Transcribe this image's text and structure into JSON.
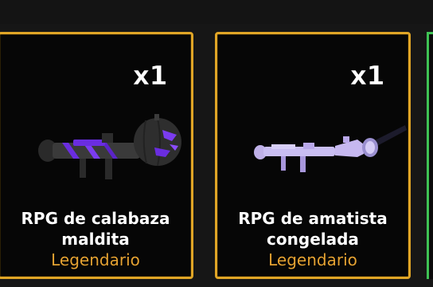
{
  "inventory": {
    "items": [
      {
        "name": "RPG de calabaza maldita",
        "rarity": "Legendario",
        "quantity": "x1",
        "icon": "cursed-pumpkin-rpg-icon"
      },
      {
        "name": "RPG de amatista congelada",
        "rarity": "Legendario",
        "quantity": "x1",
        "icon": "frozen-amethyst-rpg-icon"
      }
    ]
  },
  "colors": {
    "legendary_border": "#e0a526",
    "legendary_text": "#e5a232",
    "next_card_border": "#3fc254"
  }
}
